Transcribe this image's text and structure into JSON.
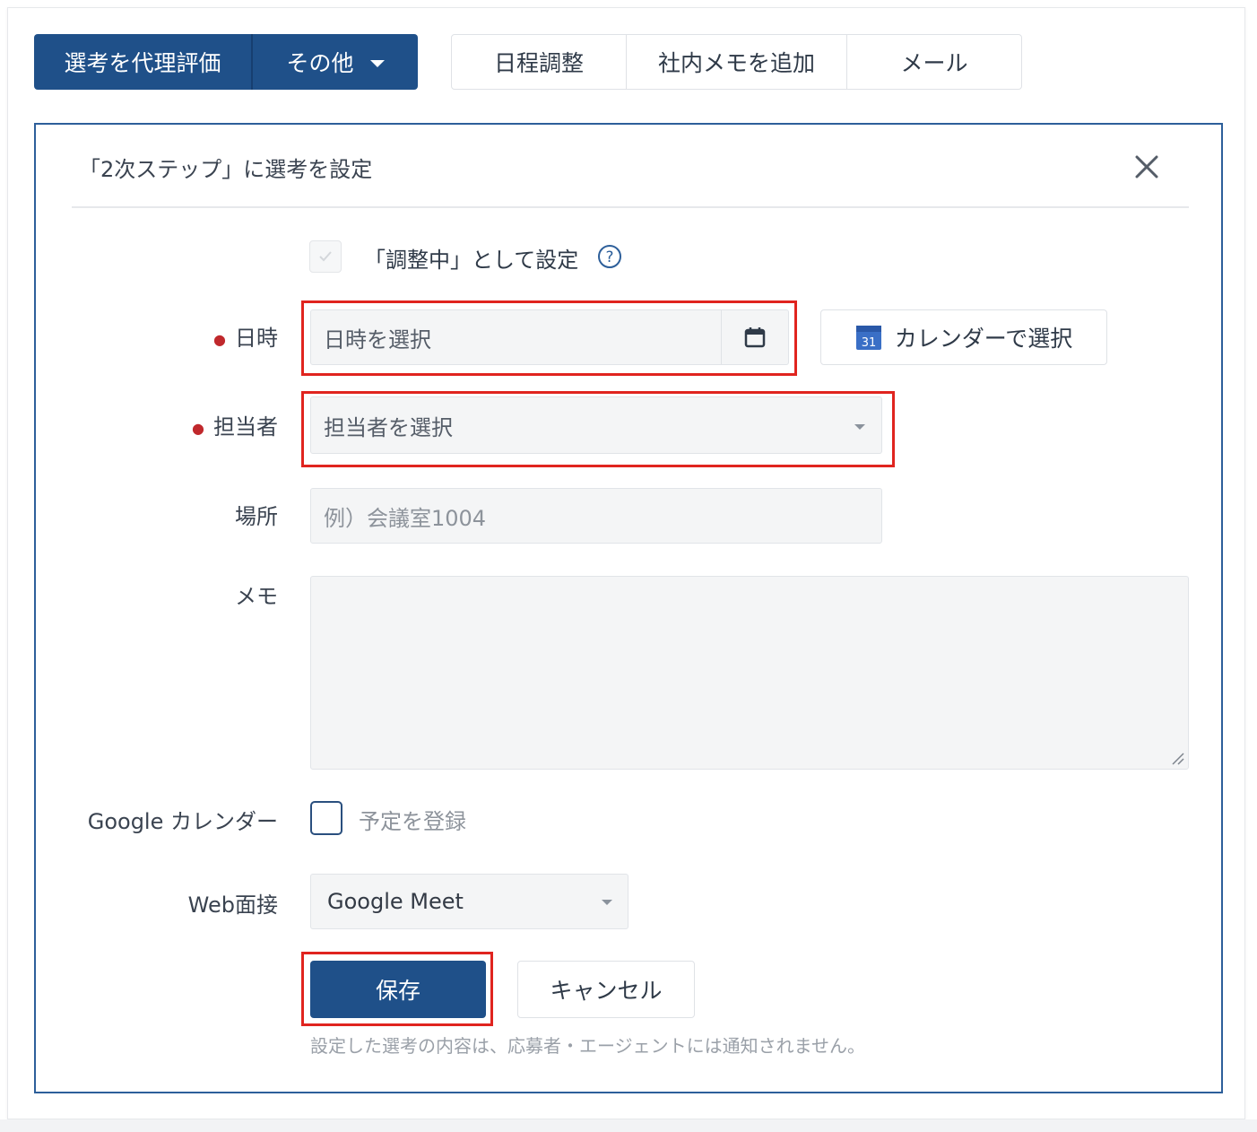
{
  "toolbar": {
    "evaluate_label": "選考を代理評価",
    "other_label": "その他",
    "schedule_label": "日程調整",
    "add_memo_label": "社内メモを追加",
    "mail_label": "メール"
  },
  "panel": {
    "title": "「2次ステップ」に選考を設定",
    "adjusting_label": "「調整中」として設定",
    "fields": {
      "datetime_label": "日時",
      "datetime_placeholder": "日時を選択",
      "calendar_button_label": "カレンダーで選択",
      "person_label": "担当者",
      "person_placeholder": "担当者を選択",
      "place_label": "場所",
      "place_placeholder": "例）会議室1004",
      "memo_label": "メモ",
      "memo_value": "",
      "gcal_label": "Google カレンダー",
      "gcal_checkbox_label": "予定を登録",
      "web_label": "Web面接",
      "web_value": "Google Meet"
    },
    "actions": {
      "save_label": "保存",
      "cancel_label": "キャンセル"
    },
    "footnote": "設定した選考の内容は、応募者・エージェントには通知されません。"
  },
  "icons": {
    "close": "close-icon",
    "help": "help-icon",
    "calendar": "calendar-icon",
    "google_calendar": "google-calendar-icon",
    "caret": "chevron-down-icon"
  },
  "colors": {
    "primary": "#1f5089",
    "highlight": "#e0241f",
    "required": "#c0282c",
    "panel_border": "#2d5f9a"
  }
}
